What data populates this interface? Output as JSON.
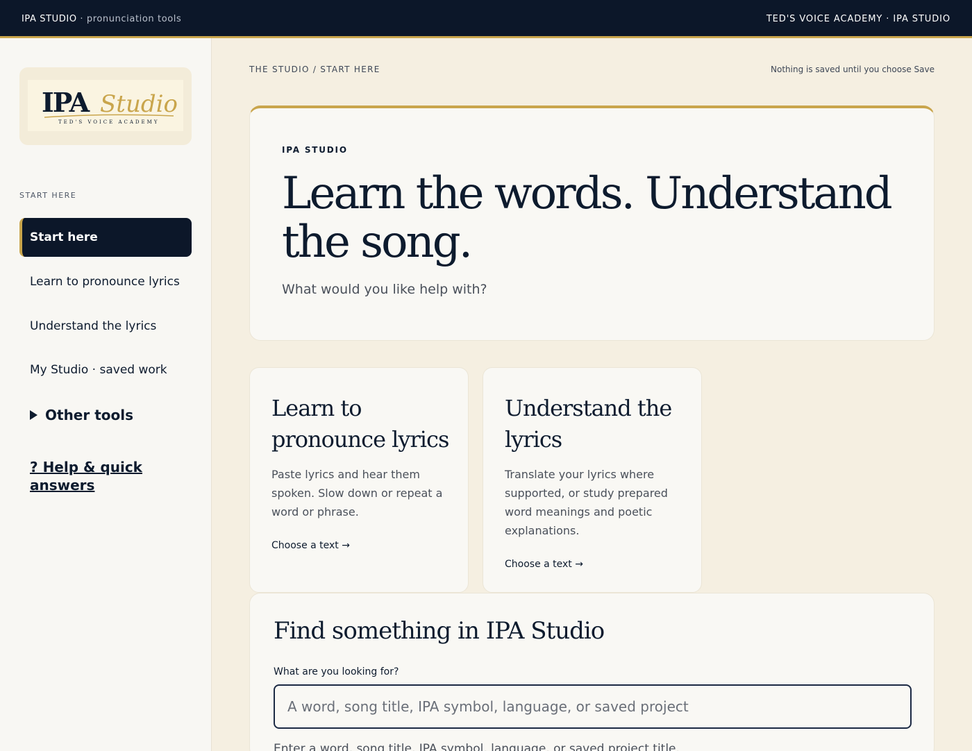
{
  "topbar": {
    "brand": "IPA STUDIO",
    "brand_sub": " · pronunciation tools",
    "right": "TED'S VOICE ACADEMY · IPA STUDIO"
  },
  "sidebar": {
    "logo": {
      "word": "IPA",
      "script": "Studio",
      "tagline": "TED'S VOICE ACADEMY"
    },
    "heading": "START HERE",
    "items": [
      {
        "label": "Start here",
        "active": true
      },
      {
        "label": "Learn to pronounce lyrics"
      },
      {
        "label": "Understand the lyrics"
      },
      {
        "label": "My Studio · saved work"
      }
    ],
    "other_tools": "Other tools",
    "help": "? Help & quick answers"
  },
  "main": {
    "breadcrumb": "THE STUDIO / START HERE",
    "save_note": "Nothing is saved until you choose Save",
    "hero": {
      "eyebrow": "IPA STUDIO",
      "title": "Learn the words. Understand the song.",
      "lead": "What would you like help with?"
    },
    "cards": [
      {
        "title": "Learn to pronounce lyrics",
        "body": "Paste lyrics and hear them spoken. Slow down or repeat a word or phrase.",
        "cta": "Choose a text →"
      },
      {
        "title": "Understand the lyrics",
        "body": "Translate your lyrics where supported, or study prepared word meanings and poetic explanations.",
        "cta": "Choose a text →"
      }
    ],
    "find": {
      "title": "Find something in IPA Studio",
      "label": "What are you looking for?",
      "placeholder": "A word, song title, IPA symbol, language, or saved project",
      "hint": "Enter a word, song title, IPA symbol, language, or saved project title."
    }
  },
  "colors": {
    "navy": "#0c1729",
    "gold": "#c9a54c",
    "cream": "#f5efe1",
    "card": "#f9f8f4"
  }
}
